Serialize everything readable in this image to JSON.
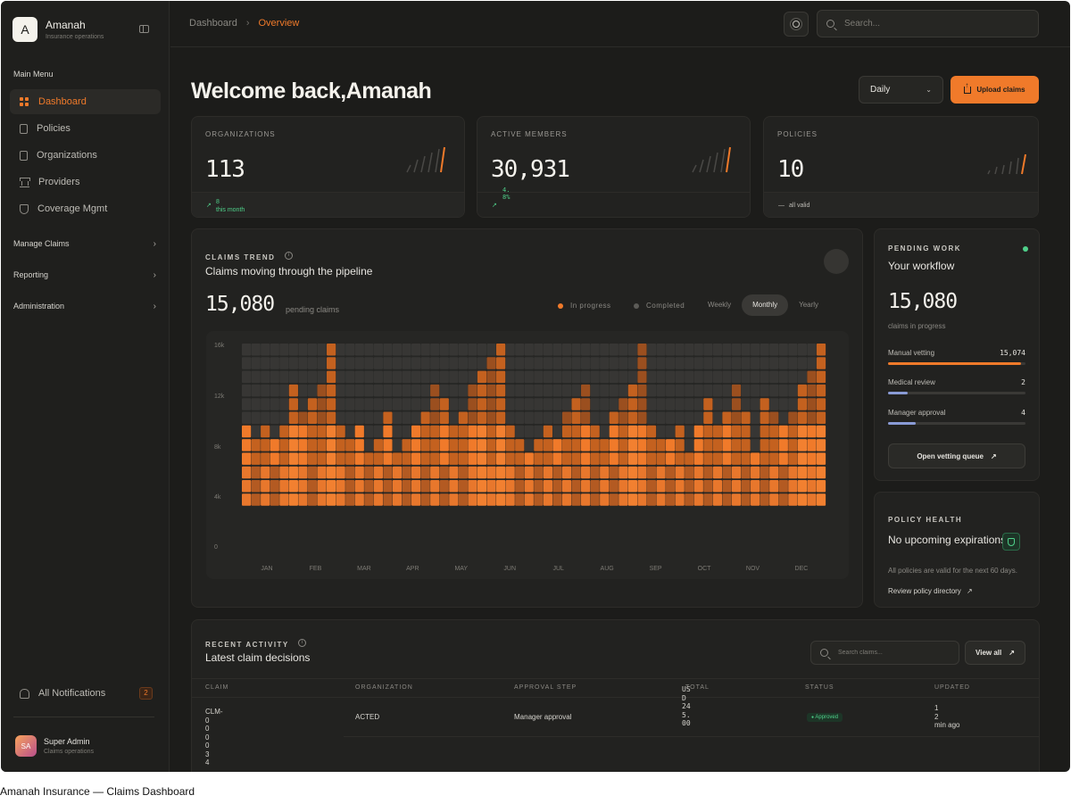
{
  "brand": {
    "initial": "A",
    "name": "Amanah",
    "subtitle": "Insurance operations"
  },
  "sidebar": {
    "menu_title": "Main Menu",
    "items": [
      {
        "label": "Dashboard",
        "icon": "grid-icon",
        "active": true
      },
      {
        "label": "Policies",
        "icon": "document-icon"
      },
      {
        "label": "Organizations",
        "icon": "building-icon"
      },
      {
        "label": "Providers",
        "icon": "bank-icon"
      },
      {
        "label": "Coverage Mgmt",
        "icon": "shield-icon"
      }
    ],
    "sections": [
      {
        "label": "Manage Claims"
      },
      {
        "label": "Reporting"
      },
      {
        "label": "Administration"
      }
    ],
    "notifications": {
      "label": "All Notifications",
      "count": "2"
    },
    "user": {
      "initials": "SA",
      "name": "Super Admin",
      "role": "Claims operations"
    }
  },
  "breadcrumb": {
    "root": "Dashboard",
    "current": "Overview"
  },
  "search": {
    "placeholder": "Search..."
  },
  "welcome": "Welcome back,Amanah",
  "period_select": {
    "value": "Daily"
  },
  "upload_button": "Upload claims",
  "stats": [
    {
      "label": "ORGANIZATIONS",
      "value": "113",
      "delta": "8",
      "delta_note": "this month"
    },
    {
      "label": "ACTIVE MEMBERS",
      "value": "30,931",
      "delta": "4.8%"
    },
    {
      "label": "POLICIES",
      "value": "10",
      "note": "all valid"
    }
  ],
  "claims_trend": {
    "label": "CLAIMS TREND",
    "title": "Claims moving through the pipeline",
    "value": "15,080",
    "value_sub": "pending claims",
    "legend": [
      {
        "label": "In progress",
        "color": "#f07a2a"
      },
      {
        "label": "Completed",
        "color": "#5c5b57"
      }
    ],
    "ranges": [
      "Weekly",
      "Monthly",
      "Yearly"
    ],
    "active_range": "Monthly"
  },
  "chart_data": {
    "type": "heatmap",
    "y_ticks": [
      "16k",
      "12k",
      "8k",
      "4k",
      "0"
    ],
    "months": [
      "JAN",
      "FEB",
      "MAR",
      "APR",
      "MAY",
      "JUN",
      "JUL",
      "AUG",
      "SEP",
      "OCT",
      "NOV",
      "DEC"
    ],
    "ylim": [
      0,
      16000
    ],
    "levels": [
      6,
      5,
      6,
      5,
      6,
      9,
      7,
      8,
      9,
      12,
      6,
      5,
      6,
      4,
      5,
      7,
      4,
      5,
      6,
      7,
      9,
      8,
      6,
      7,
      9,
      10,
      11,
      12,
      6,
      5,
      4,
      5,
      6,
      5,
      7,
      8,
      9,
      6,
      5,
      7,
      8,
      9,
      12,
      6,
      5,
      5,
      6,
      4,
      6,
      8,
      6,
      7,
      9,
      7,
      4,
      8,
      7,
      6,
      7,
      9,
      10,
      12
    ],
    "cell_value": 1000
  },
  "pending_work": {
    "label": "PENDING WORK",
    "title": "Your workflow",
    "value": "15,080",
    "value_sub": "claims in progress",
    "rows": [
      {
        "label": "Manual vetting",
        "value": "15,074",
        "fraction": 0.97,
        "color": "#f07a2a"
      },
      {
        "label": "Medical review",
        "value": "2",
        "fraction": 0.14,
        "color": "#8a9bd6"
      },
      {
        "label": "Manager approval",
        "value": "4",
        "fraction": 0.2,
        "color": "#8a9bd6"
      }
    ],
    "button": "Open vetting queue"
  },
  "policy_health": {
    "label": "POLICY HEALTH",
    "title": "No upcoming expirations",
    "note": "All policies are valid for the next 60 days.",
    "link": "Review policy directory"
  },
  "recent_activity": {
    "label": "RECENT ACTIVITY",
    "title": "Latest claim decisions",
    "search_placeholder": "Search claims...",
    "view_all": "View all",
    "columns": [
      "CLAIM",
      "ORGANIZATION",
      "APPROVAL STEP",
      "TOTAL",
      "STATUS",
      "UPDATED"
    ],
    "rows": [
      {
        "claim": "CLM-000034",
        "organization": "ACTED",
        "step": "Manager approval",
        "total": "USD 245.00",
        "status": "Approved",
        "updated": "12 min ago"
      }
    ]
  },
  "caption": "Amanah Insurance — Claims Dashboard",
  "colors": {
    "accent": "#f07a2a",
    "success": "#4fd08a",
    "background": "#1c1c1a"
  }
}
